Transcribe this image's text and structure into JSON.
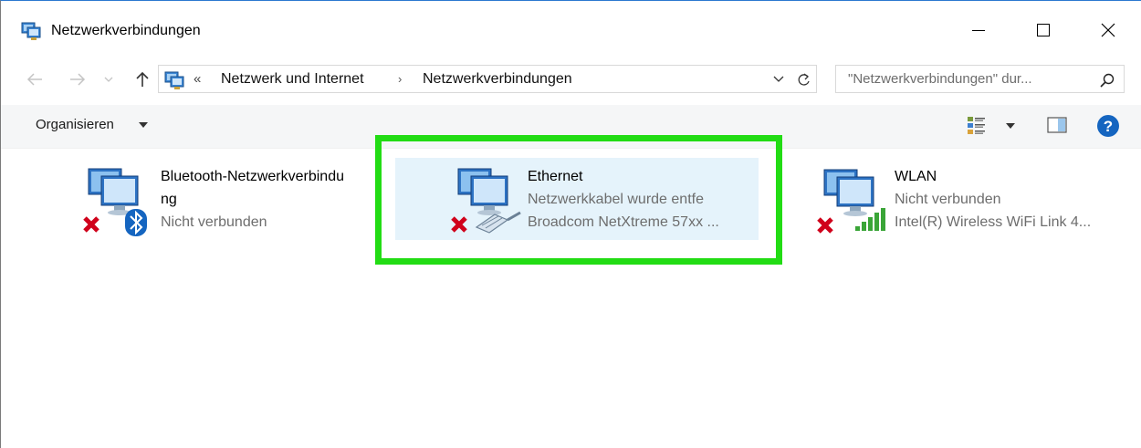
{
  "window": {
    "title": "Netzwerkverbindungen",
    "buttons": {
      "minimize": "—",
      "maximize": "☐",
      "close": "✕"
    }
  },
  "addressbar": {
    "overflow": "«",
    "crumbs": [
      "Netzwerk und Internet",
      "Netzwerkverbindungen"
    ],
    "separator": "›"
  },
  "search": {
    "placeholder": "\"Netzwerkverbindungen\" dur..."
  },
  "commandbar": {
    "organize_label": "Organisieren"
  },
  "connections": [
    {
      "name": "Bluetooth-Netzwerkverbindu\nng",
      "status": "Nicht verbunden",
      "device": "",
      "adapter_icon": "bluetooth-icon",
      "state_icon": "disconnected-x-icon"
    },
    {
      "name": "Ethernet",
      "status": "Netzwerkkabel wurde entfe",
      "device": "Broadcom NetXtreme 57xx ...",
      "adapter_icon": "ethernet-cable-icon",
      "state_icon": "disconnected-x-icon",
      "selected": true
    },
    {
      "name": "WLAN",
      "status": "Nicht verbunden",
      "device": "Intel(R) Wireless WiFi Link 4...",
      "adapter_icon": "wifi-signal-icon",
      "state_icon": "disconnected-x-icon"
    }
  ],
  "colors": {
    "highlight_border": "#22dc14",
    "selection_bg": "#e5f3fb",
    "help_blue": "#1565c0",
    "error_red": "#d0021b"
  }
}
